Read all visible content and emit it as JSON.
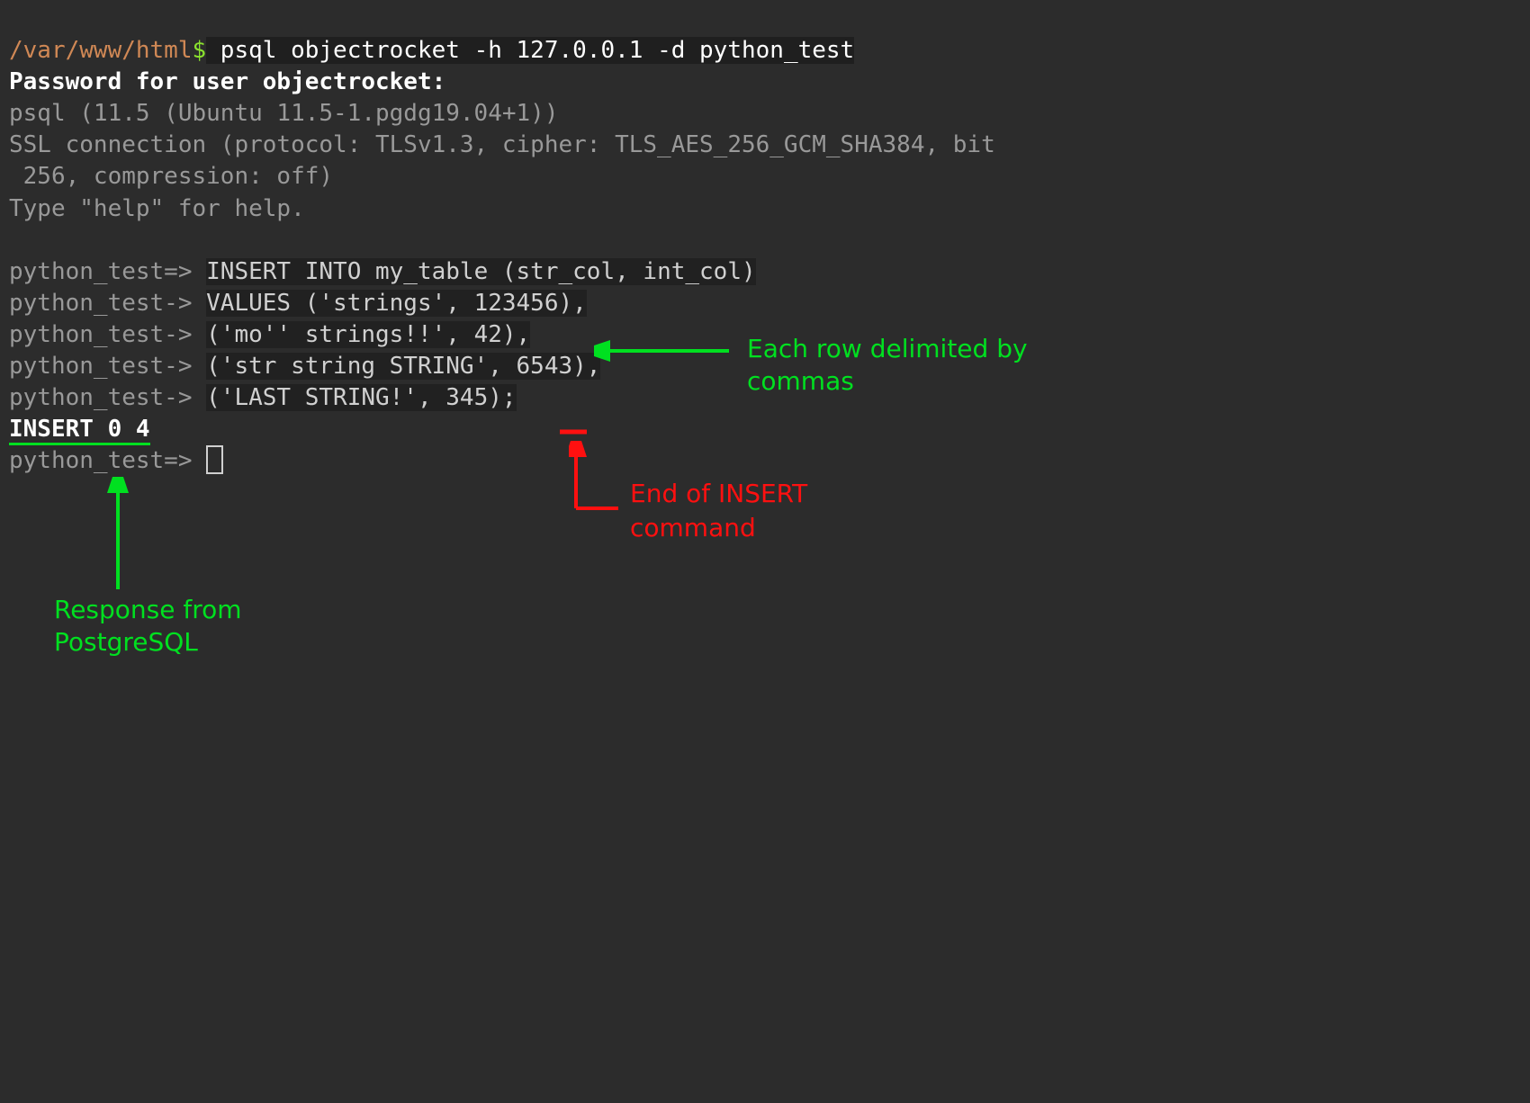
{
  "prompt": {
    "path": "/var/www/html",
    "dollar": "$",
    "command": " psql objectrocket -h 127.0.0.1 -d python_test"
  },
  "lines": {
    "password": "Password for user objectrocket:",
    "psql_ver": "psql (11.5 (Ubuntu 11.5-1.pgdg19.04+1))",
    "ssl1": "SSL connection (protocol: TLSv1.3, cipher: TLS_AES_256_GCM_SHA384, bit",
    "ssl2": " 256, compression: off)",
    "help": "Type \"help\" for help.",
    "blank": "",
    "p1a": "python_test=> ",
    "p1b": "INSERT INTO my_table (str_col, int_col)",
    "p2a": "python_test-> ",
    "p2b": "VALUES ('strings', 123456),",
    "p3a": "python_test-> ",
    "p3b": "('mo'' strings!!', 42),",
    "p4a": "python_test-> ",
    "p4b": "('str string STRING', 6543),",
    "p5a": "python_test-> ",
    "p5b": "('LAST STRING!', 345);",
    "result": "INSERT 0 4",
    "p6a": "python_test=> "
  },
  "annotations": {
    "commas": "Each row delimited by commas",
    "endinsert": "End of INSERT command",
    "response": "Response from PostgreSQL"
  }
}
